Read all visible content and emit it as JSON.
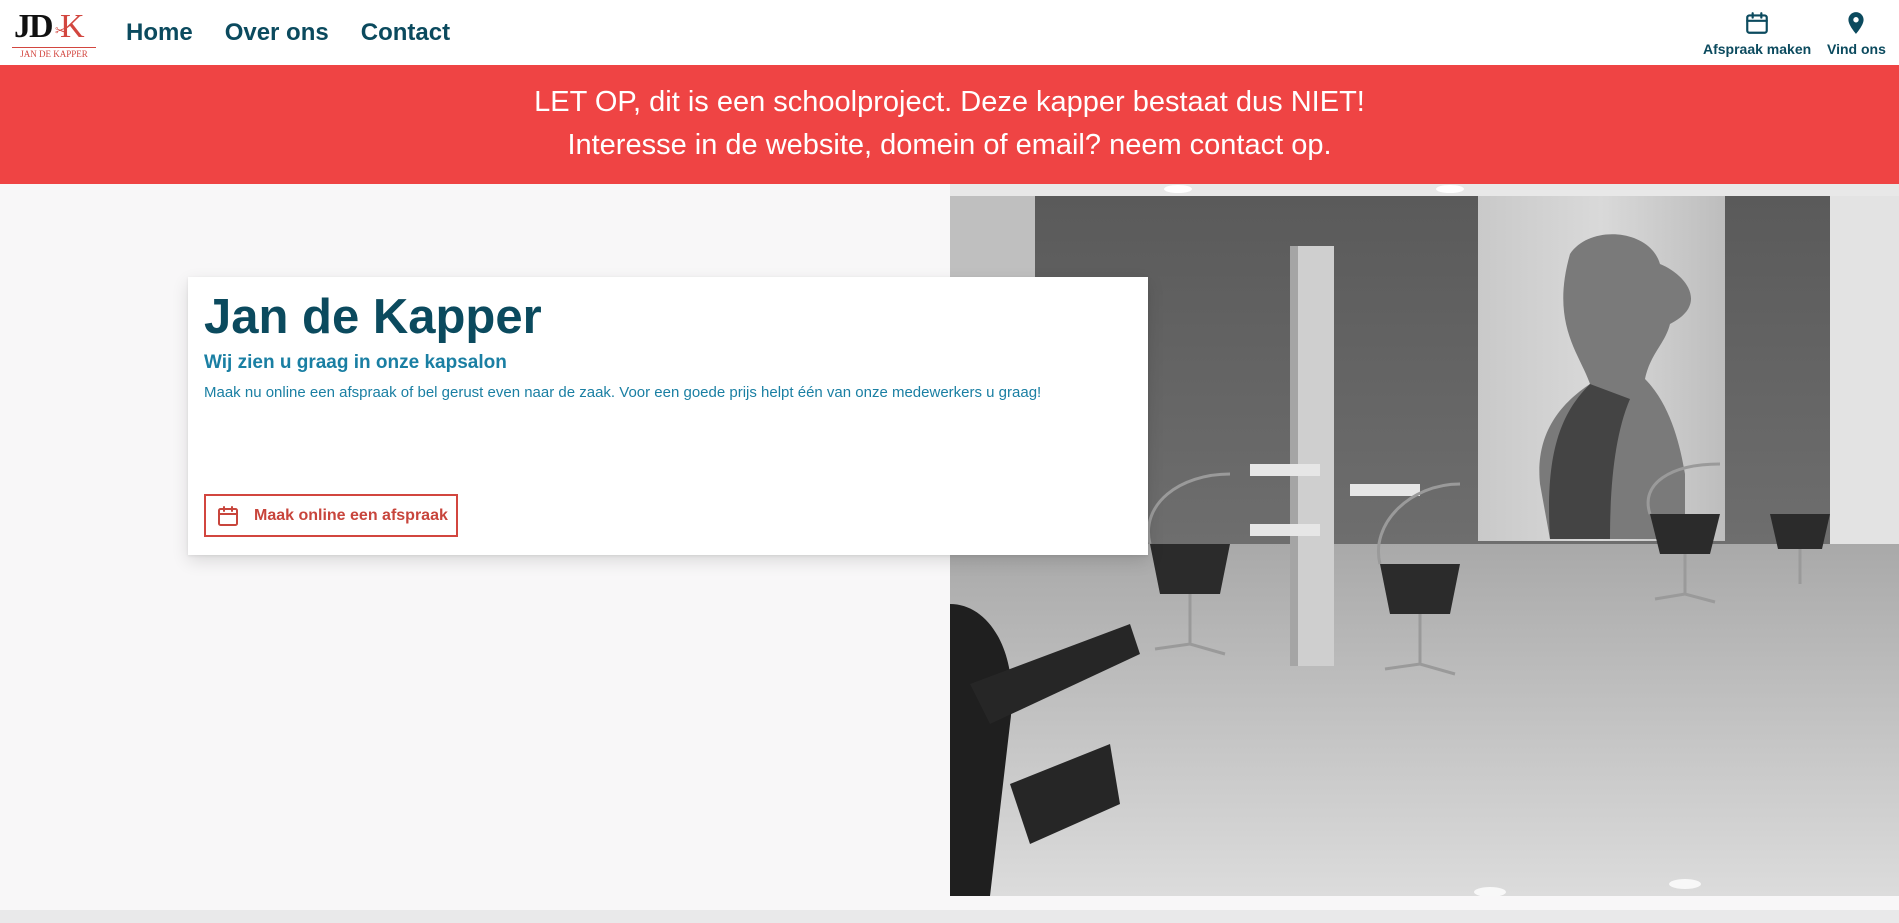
{
  "logo": {
    "monogram_jd": "JD",
    "monogram_k": "K",
    "subtitle": "JAN DE KAPPER"
  },
  "nav": {
    "items": [
      {
        "label": "Home"
      },
      {
        "label": "Over ons"
      },
      {
        "label": "Contact"
      }
    ]
  },
  "header_actions": {
    "appointment": {
      "label": "Afspraak maken",
      "icon": "calendar-icon"
    },
    "find_us": {
      "label": "Vind ons",
      "icon": "map-pin-icon"
    }
  },
  "notice": {
    "line1": "LET OP, dit is een schoolproject. Deze kapper bestaat dus NIET!",
    "line2": "Interesse in de website, domein of email? neem contact op."
  },
  "hero": {
    "title": "Jan de Kapper",
    "subtitle": "Wij zien u graag in onze kapsalon",
    "text": "Maak nu online een afspraak of bel gerust even naar de zaak. Voor een goede prijs helpt één van onze medewerkers u graag!",
    "cta": {
      "label": "Maak online een afspraak",
      "icon": "calendar-icon"
    }
  },
  "colors": {
    "primary": "#0b4a5e",
    "accent_blue": "#1a7fa3",
    "accent_red": "#d2463f",
    "banner": "#ef4444",
    "background": "#f8f7f8"
  }
}
